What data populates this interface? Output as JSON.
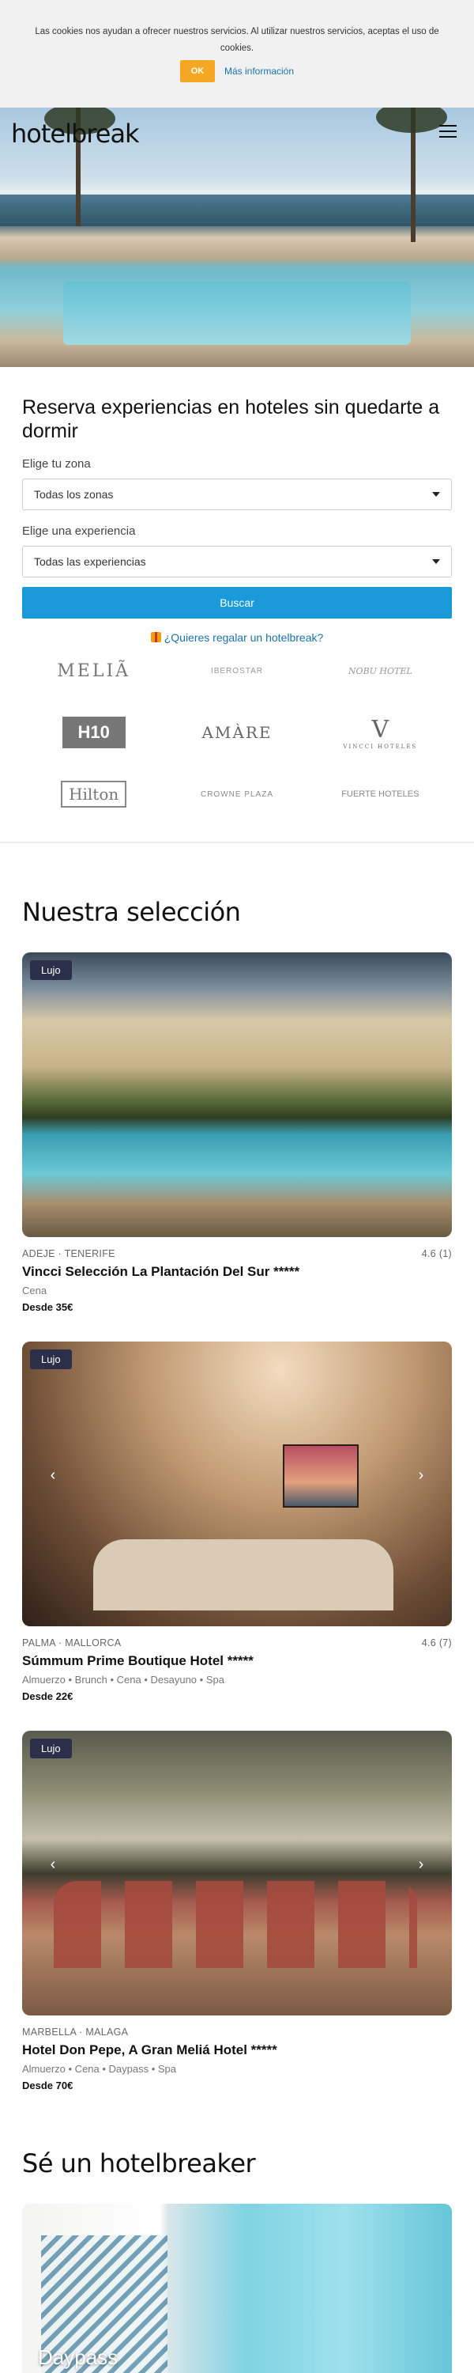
{
  "cookie": {
    "text": "Las cookies nos ayudan a ofrecer nuestros servicios. Al utilizar nuestros servicios, aceptas el uso de cookies.",
    "ok_label": "OK",
    "more_label": "Más información"
  },
  "header": {
    "logo": "hotelbreak"
  },
  "search": {
    "title": "Reserva experiencias en hoteles sin quedarte a dormir",
    "zone_label": "Elige tu zona",
    "zone_value": "Todas los zonas",
    "experience_label": "Elige una experiencia",
    "experience_value": "Todas las experiencias",
    "button_label": "Buscar",
    "gift_link": "¿Quieres regalar un hotelbreak?"
  },
  "brands": {
    "melia": "MELIÃ",
    "iberostar": "IBEROSTAR",
    "nobu": "NOBU HOTEL",
    "h10": "H10",
    "amare": "AMÀRE",
    "vincci": "V",
    "vincci_sub": "VINCCI HOTELES",
    "hilton": "Hilton",
    "crowne": "CROWNE PLAZA",
    "fuerte": "FUERTE HOTELES"
  },
  "selection": {
    "title": "Nuestra selección",
    "cards": [
      {
        "badge": "Lujo",
        "location": "ADEJE · TENERIFE",
        "rating": "4.6 (1)",
        "name": "Vincci Selección La Plantación Del Sur *****",
        "tags": "Cena",
        "price": "Desde 35€"
      },
      {
        "badge": "Lujo",
        "location": "PALMA · MALLORCA",
        "rating": "4.6 (7)",
        "name": "Súmmum Prime Boutique Hotel *****",
        "tags": "Almuerzo • Brunch • Cena • Desayuno • Spa",
        "price": "Desde 22€"
      },
      {
        "badge": "Lujo",
        "location": "MARBELLA · MALAGA",
        "rating": "",
        "name": "Hotel Don Pepe, A Gran Meliá Hotel *****",
        "tags": "Almuerzo • Cena • Daypass • Spa",
        "price": "Desde 70€"
      }
    ]
  },
  "hotelbreaker": {
    "title": "Sé un hotelbreaker",
    "card_label": "Daypass"
  },
  "colors": {
    "accent_blue": "#1b9ad9",
    "cookie_ok": "#f5a623",
    "badge": "#2c2f4a"
  }
}
